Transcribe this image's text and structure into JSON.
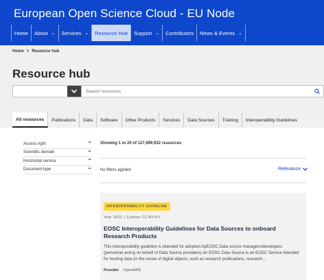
{
  "header": {
    "brand": "European Open Science Cloud - EU Node",
    "nav": [
      {
        "label": "Home",
        "chevron": false,
        "active": false
      },
      {
        "label": "About",
        "chevron": true,
        "active": false
      },
      {
        "label": "Services",
        "chevron": true,
        "active": false
      },
      {
        "label": "Resource Hub",
        "chevron": false,
        "active": true
      },
      {
        "label": "Support",
        "chevron": true,
        "active": false
      },
      {
        "label": "Contributors",
        "chevron": false,
        "active": false
      },
      {
        "label": "News & Events",
        "chevron": true,
        "active": false
      }
    ]
  },
  "breadcrumb": {
    "home": "Home",
    "separator": ">",
    "current": "Resource hub"
  },
  "page_title": "Resource hub",
  "search": {
    "placeholder": "Search resources",
    "scope_value": ""
  },
  "tabs": [
    {
      "label": "All resources",
      "active": true
    },
    {
      "label": "Publications",
      "active": false
    },
    {
      "label": "Data",
      "active": false
    },
    {
      "label": "Software",
      "active": false
    },
    {
      "label": "Other Products",
      "active": false
    },
    {
      "label": "Services",
      "active": false
    },
    {
      "label": "Data Sources",
      "active": false
    },
    {
      "label": "Training",
      "active": false
    },
    {
      "label": "Interoperability Guidelines",
      "active": false
    }
  ],
  "filters": [
    {
      "label": "Access right"
    },
    {
      "label": "Scientific domain"
    },
    {
      "label": "Horizontal service"
    },
    {
      "label": "Document type"
    }
  ],
  "results": {
    "count_text": "Showing 1 to 20 of 127,999,932 resources",
    "no_filters": "No filters applied",
    "sort_label": "Relevance"
  },
  "card": {
    "badge": "INTEROPERABILITY GUIDELINE",
    "year": "Year: 2023",
    "meta_sep": "|",
    "license": "License: CC-BY-4.0",
    "title": "EOSC Interoperability Guidelines for Data Sources to onboard Research Products",
    "description": "This interoperability guideline is intended for adoption byEOSC Data source managers/developers (personnel acting on behalf of Data Source providers).An EOSC Data Source is an EOSC Service intended for hosting data (in the sense of digital objects, such as research publications, research…",
    "provider_label": "Provider",
    "provider_value": "OpenAIRE"
  },
  "colors": {
    "brand_blue": "#0e47cb",
    "badge_yellow": "#ffd83d",
    "band_grey": "#f0f0f0"
  },
  "icons": {
    "chevron_down": "chevron-down-icon",
    "chevron_up": "chevron-up-icon",
    "search": "search-icon"
  }
}
